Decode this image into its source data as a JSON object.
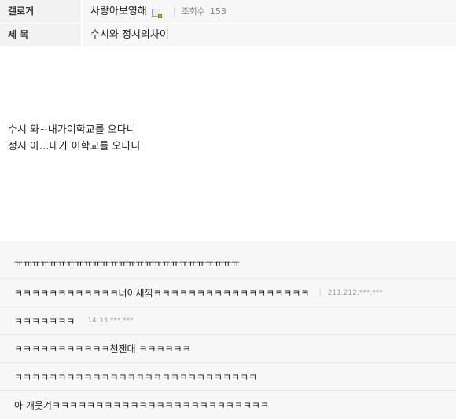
{
  "header": {
    "gallery_label": "갤로거",
    "author": "사랑아보영해",
    "views_label": "조회수",
    "views_count": "153",
    "title_label": "제 목",
    "title": "수시와 정시의차이"
  },
  "post": {
    "lines": [
      "수시 와~내가이학교를 오다니",
      "정시 아...내가 이학교를 오다니"
    ]
  },
  "comments": [
    {
      "text": "ㅠㅠㅠㅠㅠㅠㅠㅠㅠㅠㅠㅠㅠㅠㅠㅠㅠㅠㅠㅠㅠㅠㅠㅠㅠㅠ",
      "ip": ""
    },
    {
      "text": "ㅋㅋㅋㅋㅋㅋㅋㅋㅋㅋㅋㅋ너이새낔ㅋㅋㅋㅋㅋㅋㅋㅋㅋㅋㅋㅋㅋㅋㅋㅋㅋㅋ",
      "ip": "211.212.***.***"
    },
    {
      "text": "ㅋㅋㅋㅋㅋㅋㅋ",
      "ip": "14.33.***.***"
    },
    {
      "text": "ㅋㅋㅋㅋㅋㅋㅋㅋㅋㅋㅋ천잰대 ㅋㅋㅋㅋㅋㅋ",
      "ip": ""
    },
    {
      "text": "ㅋㅋㅋㅋㅋㅋㅋㅋㅋㅋㅋㅋㅋㅋㅋㅋㅋㅋㅋㅋㅋㅋㅋㅋㅋㅋㅋㅋ",
      "ip": ""
    },
    {
      "text": "아 개웃겨ㅋㅋㅋㅋㅋㅋㅋㅋㅋㅋㅋㅋㅋㅋㅋㅋㅋㅋㅋㅋㅋㅋㅋㅋㅋ",
      "ip": ""
    }
  ]
}
